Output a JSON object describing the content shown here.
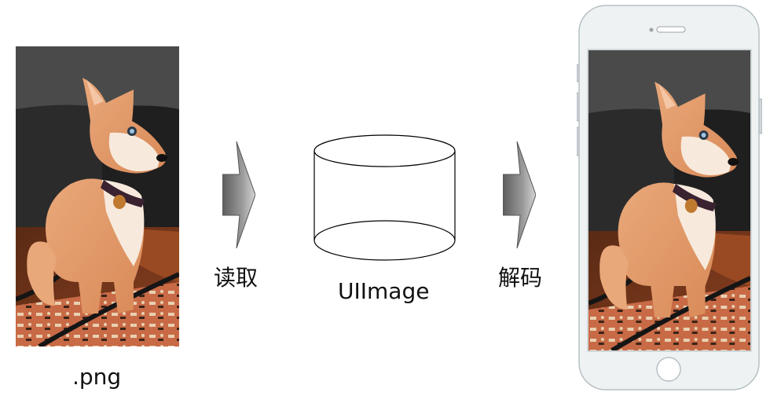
{
  "source": {
    "file_label": ".png",
    "image_alt": "dog-photo"
  },
  "step_read": {
    "label": "读取"
  },
  "store": {
    "label": "UIImage"
  },
  "step_decode": {
    "label": "解码"
  },
  "device": {
    "name": "phone"
  }
}
